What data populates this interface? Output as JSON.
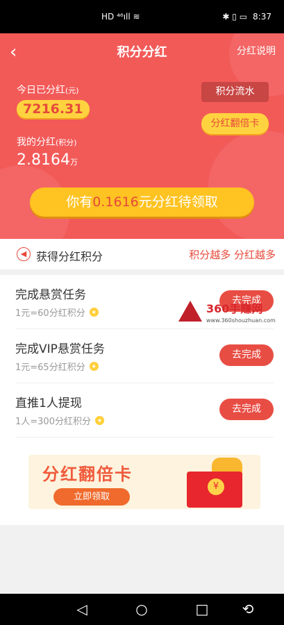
{
  "status_bar": {
    "left_icons": "HD ⁴⁶ıll ≋",
    "right_icons": "✱ ▯ ▭",
    "time": "8:37"
  },
  "nav": {
    "back_icon": "‹",
    "title": "积分分红",
    "right_link": "分红说明"
  },
  "summary": {
    "today_label": "今日已分红",
    "today_unit": "(元)",
    "today_value": "7216.31",
    "mine_label": "我的分红",
    "mine_unit": "(积分)",
    "mine_value": "2.8164",
    "mine_value_unit": "万",
    "flow_button": "积分流水",
    "card_button": "分红翻倍卡"
  },
  "claim": {
    "prefix": "你有",
    "amount": "0.1616",
    "suffix": "元分红待领取"
  },
  "earn": {
    "title": "获得分红积分",
    "slogan": "积分越多 分红越多"
  },
  "tasks": [
    {
      "title": "完成悬赏任务",
      "subtitle": "1元=60分红积分",
      "button": "去完成"
    },
    {
      "title": "完成VIP悬赏任务",
      "subtitle": "1元=65分红积分",
      "button": "去完成"
    },
    {
      "title": "直推1人提现",
      "subtitle": "1人=300分红积分",
      "button": "去完成"
    }
  ],
  "banner": {
    "title": "分红翻倍卡",
    "button": "立即领取",
    "coin_symbol": "¥"
  },
  "watermark": {
    "text": "360手赚网",
    "url": "www.360shouzhuan.com"
  },
  "colors": {
    "primary": "#f25a58",
    "accent_yellow": "#ffd33f",
    "button_red": "#e84d44"
  }
}
